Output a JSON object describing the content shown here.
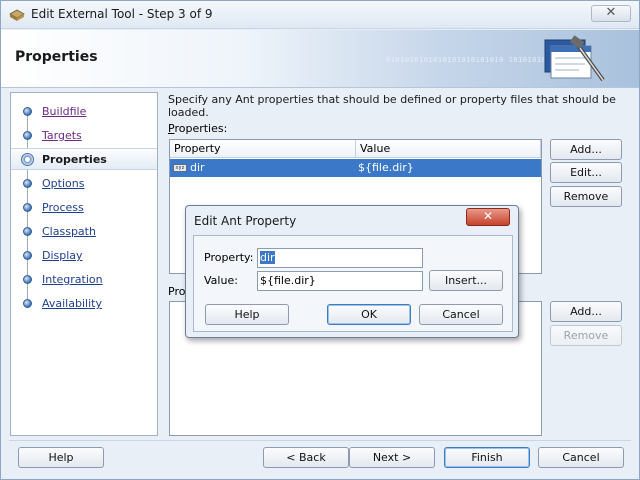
{
  "window": {
    "title": "Edit External Tool - Step 3 of 9",
    "close_glyph": "✕"
  },
  "header": {
    "title": "Properties",
    "binary_watermark": "0101010101010101010101010 1010101010"
  },
  "nav": {
    "items": [
      {
        "label": "Buildfile",
        "state": "visited"
      },
      {
        "label": "Targets",
        "state": "visited"
      },
      {
        "label": "Properties",
        "state": "current"
      },
      {
        "label": "Options",
        "state": "link"
      },
      {
        "label": "Process",
        "state": "link"
      },
      {
        "label": "Classpath",
        "state": "link"
      },
      {
        "label": "Display",
        "state": "link"
      },
      {
        "label": "Integration",
        "state": "link"
      },
      {
        "label": "Availability",
        "state": "link"
      }
    ]
  },
  "content": {
    "instructions": "Specify any Ant properties that should be defined or property files that should be loaded.",
    "properties_label": "Properties:",
    "properties_mnemonic": "P",
    "properties_rest": "roperties:",
    "table": {
      "columns": [
        "Property",
        "Value"
      ],
      "rows": [
        {
          "type_icon": "xyz",
          "property": "dir",
          "value": "${file.dir}",
          "selected": true
        }
      ]
    },
    "files_label_visible": "Prop",
    "properties_buttons": {
      "add": "Add...",
      "edit": "Edit...",
      "remove": "Remove"
    },
    "files_buttons": {
      "add": "Add...",
      "remove": "Remove"
    }
  },
  "footer": {
    "help": "Help",
    "back": "< Back",
    "next": "Next >",
    "finish": "Finish",
    "cancel": "Cancel"
  },
  "dialog": {
    "title": "Edit Ant Property",
    "close_glyph": "✕",
    "property_label": "Property:",
    "property_value": "dir",
    "value_label": "Value:",
    "value_value": "${file.dir}",
    "insert": "Insert...",
    "help": "Help",
    "ok": "OK",
    "cancel": "Cancel"
  },
  "colors": {
    "selection": "#3b78c7",
    "window_bg": "#e9eff7",
    "link": "#1f3f8f",
    "visited_link": "#6a2b84",
    "close_red": "#c6412c"
  }
}
